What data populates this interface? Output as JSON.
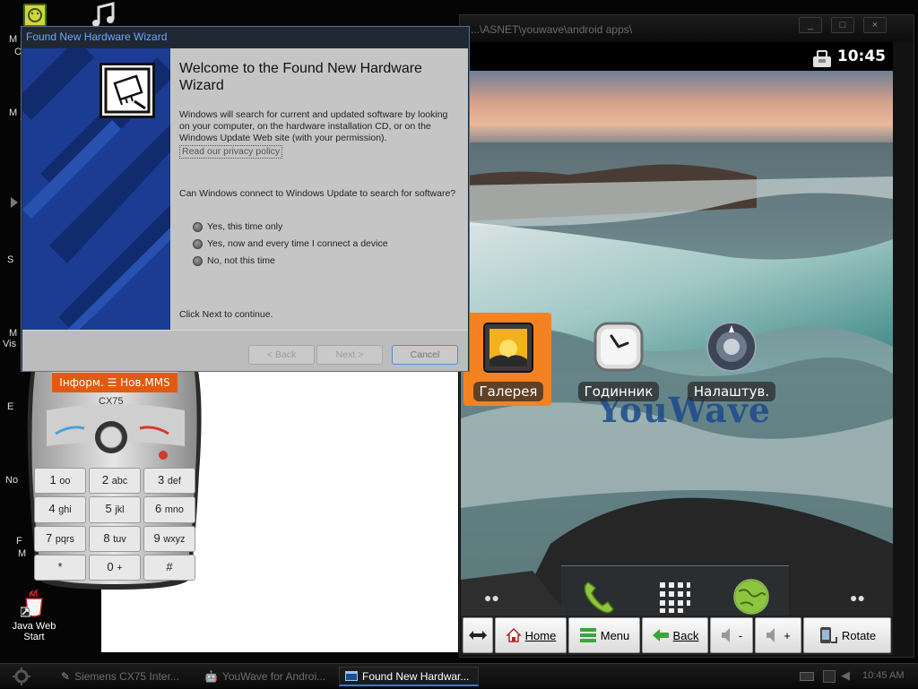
{
  "desktop": {
    "icons": [
      {
        "label": "Java Web Start"
      }
    ],
    "edge_labels": [
      "M",
      "C",
      "M",
      "S",
      "M",
      "Vis",
      "E",
      "No",
      "F",
      "M"
    ]
  },
  "youwave": {
    "title": "...\\ASNET\\youwave\\android apps\\",
    "window_buttons": [
      "_",
      "□",
      "×"
    ],
    "status_time": "10:45",
    "wallpaper_watermark": "YouWave",
    "apps": [
      {
        "label": "Галерея",
        "icon": "gallery-icon"
      },
      {
        "label": "Годинник",
        "icon": "clock-icon"
      },
      {
        "label": "Налаштув.",
        "icon": "settings-icon"
      }
    ],
    "dock": [
      "phone-icon",
      "app-grid-icon",
      "browser-globe-icon"
    ],
    "toolbar": {
      "home": "Home",
      "menu": "Menu",
      "back": "Back",
      "volume_down": "-",
      "volume_up": "+",
      "rotate": "Rotate"
    }
  },
  "phone": {
    "screen_text": "Інформ. ☰ Нов.MMS",
    "model": "CX75",
    "keys": [
      {
        "digit": "1",
        "letters": "oo"
      },
      {
        "digit": "2",
        "letters": "abc"
      },
      {
        "digit": "3",
        "letters": "def"
      },
      {
        "digit": "4",
        "letters": "ghi"
      },
      {
        "digit": "5",
        "letters": "jkl"
      },
      {
        "digit": "6",
        "letters": "mno"
      },
      {
        "digit": "7",
        "letters": "pqrs"
      },
      {
        "digit": "8",
        "letters": "tuv"
      },
      {
        "digit": "9",
        "letters": "wxyz"
      },
      {
        "digit": "*",
        "letters": ""
      },
      {
        "digit": "0",
        "letters": "+"
      },
      {
        "digit": "#",
        "letters": ""
      }
    ]
  },
  "wizard": {
    "title": "Found New Hardware Wizard",
    "heading": "Welcome to the Found New Hardware Wizard",
    "intro": "Windows will search for current and updated software by looking on your computer, on the hardware installation CD, or on the Windows Update Web site (with your permission).",
    "privacy_link": "Read our privacy policy",
    "question": "Can Windows connect to Windows Update to search for software?",
    "options": [
      "Yes, this time only",
      "Yes, now and every time I connect a device",
      "No, not this time"
    ],
    "footer_text": "Click Next to continue.",
    "buttons": {
      "back": "< Back",
      "next": "Next >",
      "cancel": "Cancel"
    }
  },
  "taskbar": {
    "tasks": [
      "Siemens CX75 Inter...",
      "YouWave for Androi...",
      "Found New Hardwar..."
    ],
    "clock": "10:45 AM"
  },
  "colors": {
    "accent_blue": "#2f7ed8",
    "wizard_banner": "#1b3c92",
    "selected_app": "#f58220",
    "phone_display": "#e15a10"
  }
}
